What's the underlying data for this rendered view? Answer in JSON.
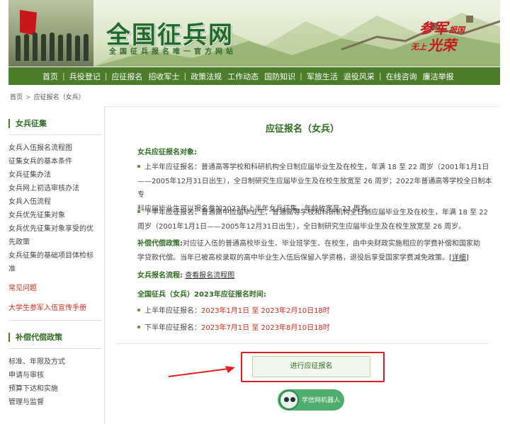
{
  "site": {
    "logo_text": "全国征兵网",
    "slogan": "全国征兵报名唯一官方网站",
    "banner_slogan_1a": "参军",
    "banner_slogan_1b": "报国",
    "banner_slogan_2a": "无上",
    "banner_slogan_2b": "光荣"
  },
  "nav": {
    "items": [
      "首页",
      "兵役登记",
      "应征报名",
      "招收军士",
      "政策法规",
      "工作动态",
      "国防知识",
      "军旅生活",
      "退役风采",
      "在线咨询",
      "廉洁举报"
    ]
  },
  "breadcrumb": {
    "home": "首页",
    "arrow": ">",
    "current": "应征报名（女兵）"
  },
  "sidebar": {
    "section1_title": "女兵征集",
    "section1_links": [
      "女兵入伍报名流程图",
      "征集女兵的基本条件",
      "女兵征集办法",
      "女兵网上初选审核办法",
      "女兵入伍流程",
      "女兵优先征集对象",
      "女兵优先征集对象享受的优",
      "先政策",
      "女兵征集的基础项目体检标",
      "准"
    ],
    "red_links": [
      "常见问题",
      "大学生参军入伍宣传手册"
    ],
    "section2_title": "补偿代偿政策",
    "section2_links": [
      "标准、年限及方式",
      "申请与审核",
      "预算下达和实施",
      "管理与监督"
    ]
  },
  "content": {
    "title": "应征报名（女兵）",
    "target_title": "女兵应征报名对象:",
    "first_half_lines": [
      "上半年应征报名：普通高等学校和科研机构全日制应届毕业生及在校生，年满 18 至 22 周岁（2001年1月1日",
      "——2005年12月31日出生），全日制研究生应届毕业生及在校生放宽至 26 周岁；2022年普通高等学校全日制本专",
      "科应届毕业生可以报名参加2023年上半年女兵征集，年龄放宽至 23 周岁。"
    ],
    "second_half_lines": [
      "下半年应征报名：普通高中应届毕业生、普通高等学校和科研机构全日制应届毕业生及在校生，年满 18 至 22",
      "周岁（2001年1月1日——2005年12月31日出生），全日制研究生应届毕业生及在校生放宽至 26 周岁。"
    ],
    "policy_label": "补偿代偿政策:",
    "policy_line1": "对应征入伍的普通高校毕业生、毕业班学生、在校生，由中央财政实施相应的学费补偿和国家助",
    "policy_line2": "学贷款代偿。当年已被高校录取的高中毕业生入伍后保留入学资格，退役后享受国家学费减免政策。",
    "policy_detail": "[详细]",
    "process_label": "女兵报名流程:",
    "process_link": "查看报名流程图",
    "time_title": "全国征兵（女兵）2023年应征报名时间:",
    "time_first_label": "上半年应征报名：",
    "time_first_value": "2023年1月1日 至 2023年2月10日18时",
    "time_second_label": "下半年应征报名：",
    "time_second_value": "2023年7月1日 至 2023年8月10日18时",
    "apply_button": "进行应征报名",
    "robot_label": "学信网机器人"
  },
  "colors": {
    "nav_bg": "#4b7d2a",
    "title_green": "#2e6b1f",
    "highlight_red": "#e02020",
    "date_red": "#d22a1f"
  }
}
